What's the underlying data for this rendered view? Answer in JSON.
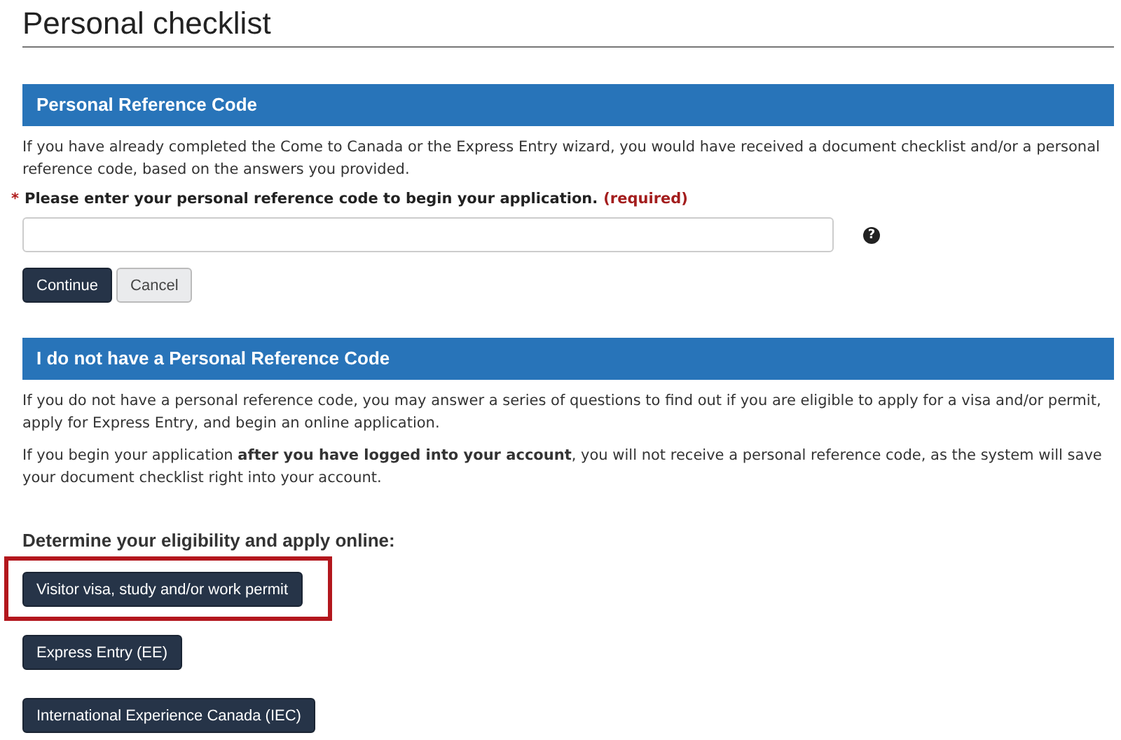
{
  "title": "Personal checklist",
  "sections": [
    {
      "heading": "Personal Reference Code",
      "paragraphs": [
        "If you have already completed the Come to Canada or the Express Entry wizard, you would have received a document checklist and/or a personal reference code, based on the answers you provided."
      ],
      "field": {
        "required_mark": "*",
        "label": "Please enter your personal reference code to begin your application.",
        "required_text": "(required)",
        "help": "?"
      },
      "buttons": [
        {
          "label": "Continue",
          "kind": "primary"
        },
        {
          "label": "Cancel",
          "kind": "secondary"
        }
      ]
    },
    {
      "heading": "I do not have a Personal Reference Code",
      "paragraphs": [
        "If you do not have a personal reference code, you may answer a series of questions to find out if you are eligible to apply for a visa and/or permit, apply for Express Entry, and begin an online application.",
        "If you begin your application **after you have logged into your account**, you will not receive a personal reference code, as the system will save your document checklist right into your account."
      ],
      "subheading": "Determine your eligibility and apply online:",
      "links": [
        {
          "label": "Visitor visa, study and/or work permit",
          "highlighted": true
        },
        {
          "label": "Express Entry (EE)",
          "highlighted": false
        },
        {
          "label": "International Experience Canada (IEC)",
          "highlighted": false
        }
      ]
    }
  ]
}
